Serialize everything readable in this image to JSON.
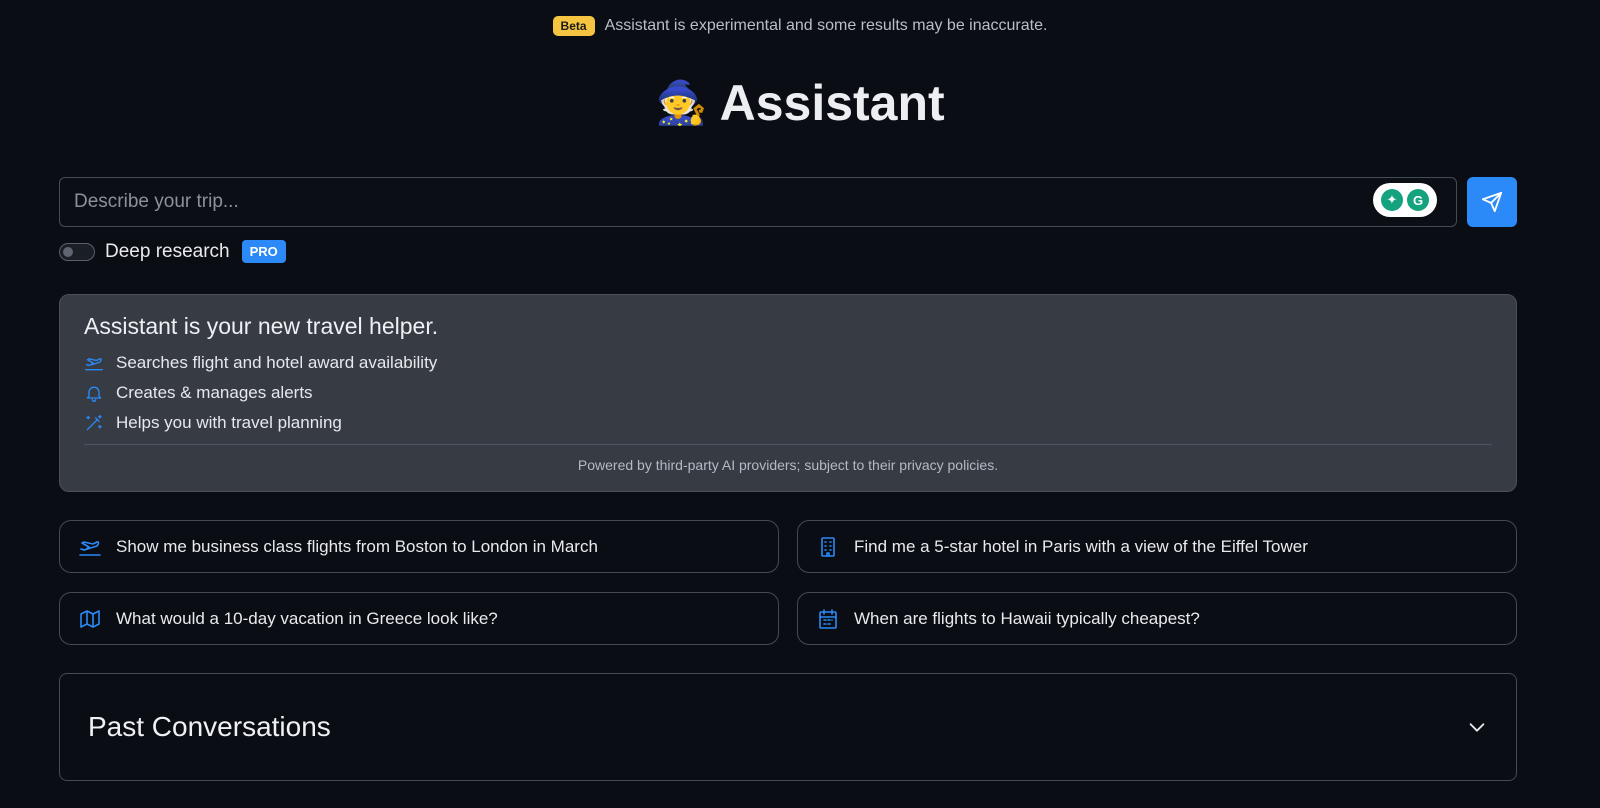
{
  "banner": {
    "badge": "Beta",
    "text": "Assistant is experimental and some results may be inaccurate."
  },
  "header": {
    "emoji": "🧙",
    "title": "Assistant"
  },
  "search": {
    "placeholder": "Describe your trip..."
  },
  "deep_research": {
    "label": "Deep research",
    "badge": "PRO",
    "enabled": false
  },
  "info": {
    "heading": "Assistant is your new travel helper.",
    "features": [
      {
        "icon": "plane-icon",
        "text": "Searches flight and hotel award availability"
      },
      {
        "icon": "bell-icon",
        "text": "Creates & manages alerts"
      },
      {
        "icon": "magic-wand-icon",
        "text": "Helps you with travel planning"
      }
    ],
    "footer": "Powered by third-party AI providers; subject to their privacy policies."
  },
  "suggestions": [
    {
      "icon": "plane-icon",
      "text": "Show me business class flights from Boston to London in March"
    },
    {
      "icon": "building-icon",
      "text": "Find me a 5-star hotel in Paris with a view of the Eiffel Tower"
    },
    {
      "icon": "map-icon",
      "text": "What would a 10-day vacation in Greece look like?"
    },
    {
      "icon": "calendar-icon",
      "text": "When are flights to Hawaii typically cheapest?"
    }
  ],
  "past": {
    "title": "Past Conversations"
  },
  "colors": {
    "accent": "#2b8af7",
    "beta": "#f5c542",
    "background": "#0a0d14",
    "card": "#373b44"
  }
}
